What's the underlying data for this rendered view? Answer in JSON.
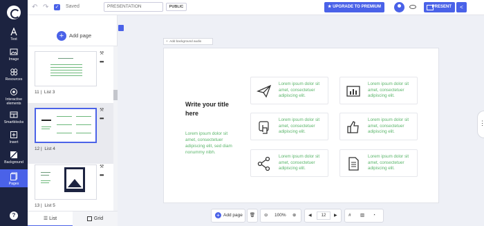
{
  "nav": {
    "items": [
      {
        "label": "Text"
      },
      {
        "label": "Image"
      },
      {
        "label": "Resources"
      },
      {
        "label": "Interactive elements"
      },
      {
        "label": "Smartblocks"
      },
      {
        "label": "Insert"
      },
      {
        "label": "Background"
      },
      {
        "label": "Pages"
      }
    ],
    "help": "?"
  },
  "topbar": {
    "saved": "Saved",
    "title_value": "PRESENTATION",
    "public_label": "PUBLIC",
    "upgrade_label": "UPGRADE TO PREMIUM",
    "present_label": "PRESENT"
  },
  "panel": {
    "add_page": "Add page",
    "thumbs": [
      {
        "num": "11",
        "name": "List 3"
      },
      {
        "num": "12",
        "name": "List 4"
      },
      {
        "num": "13",
        "name": "List 5"
      }
    ],
    "tabs": {
      "list": "List",
      "grid": "Grid"
    }
  },
  "canvas": {
    "add_background_audio": "Add background audio",
    "title": "Write your title here",
    "body": "Lorem ipsum dolor sit amet, consectetuer adipiscing elit, sed diam nonummy nibh.",
    "cards": [
      {
        "icon": "paper-plane-icon",
        "text": "Lorem ipsum dolor sit amet, consectetuer adipiscing elit."
      },
      {
        "icon": "chart-icon",
        "text": "Lorem ipsum dolor sit amet, consectetuer adipiscing elit."
      },
      {
        "icon": "hand-pointer-icon",
        "text": "Lorem ipsum dolor sit amet, consectetuer adipiscing elit."
      },
      {
        "icon": "thumbs-up-icon",
        "text": "Lorem ipsum dolor sit amet, consectetuer adipiscing elit."
      },
      {
        "icon": "share-icon",
        "text": "Lorem ipsum dolor sit amet, consectetuer adipiscing elit."
      },
      {
        "icon": "document-icon",
        "text": "Lorem ipsum dolor sit amet, consectetuer adipiscing elit."
      }
    ]
  },
  "toolbar": {
    "add_page": "Add page",
    "zoom": "100%",
    "page": "12"
  },
  "colors": {
    "accent": "#4a62e8",
    "nav_bg": "#1c2340",
    "green_text": "#5ab56a"
  }
}
